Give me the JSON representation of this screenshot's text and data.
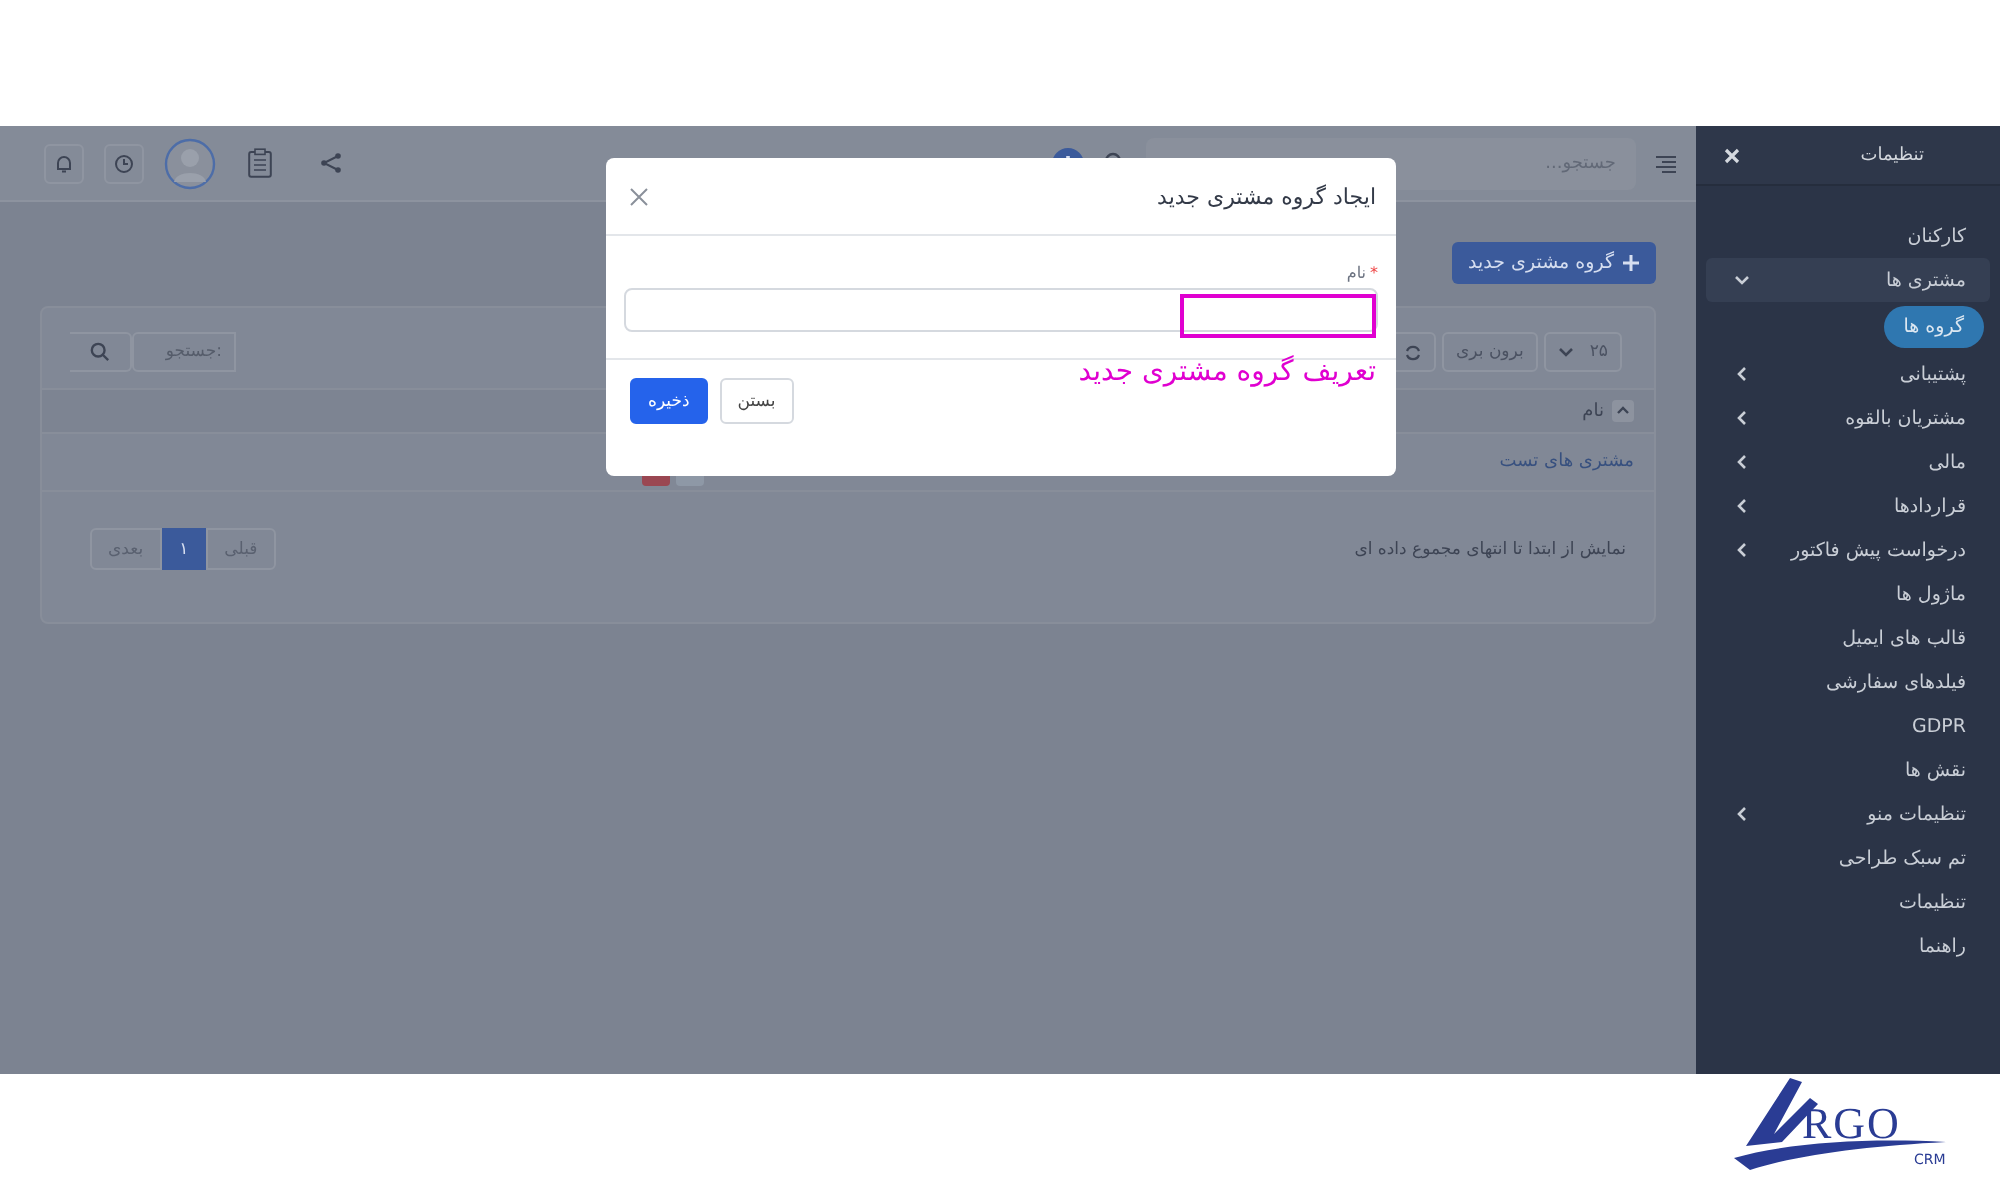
{
  "header": {
    "search_placeholder": "جستجو..."
  },
  "sidebar": {
    "title": "تنظیمات",
    "items": [
      {
        "label": "کارکنان",
        "has_submenu": false,
        "expanded": false
      },
      {
        "label": "مشتری ها",
        "has_submenu": true,
        "expanded": true,
        "children": [
          {
            "label": "گروه ها",
            "selected": true
          }
        ]
      },
      {
        "label": "پشتیبانی",
        "has_submenu": true,
        "expanded": false
      },
      {
        "label": "مشتریان بالقوه",
        "has_submenu": true,
        "expanded": false
      },
      {
        "label": "مالی",
        "has_submenu": true,
        "expanded": false
      },
      {
        "label": "قراردادها",
        "has_submenu": true,
        "expanded": false
      },
      {
        "label": "درخواست پیش فاکتور",
        "has_submenu": true,
        "expanded": false
      },
      {
        "label": "ماژول ها",
        "has_submenu": false,
        "expanded": false
      },
      {
        "label": "قالب های ایمیل",
        "has_submenu": false,
        "expanded": false
      },
      {
        "label": "فیلدهای سفارشی",
        "has_submenu": false,
        "expanded": false
      },
      {
        "label": "GDPR",
        "has_submenu": false,
        "expanded": false
      },
      {
        "label": "نقش ها",
        "has_submenu": false,
        "expanded": false
      },
      {
        "label": "تنظیمات منو",
        "has_submenu": true,
        "expanded": false
      },
      {
        "label": "تم سبک طراحی",
        "has_submenu": false,
        "expanded": false
      },
      {
        "label": "تنظیمات",
        "has_submenu": false,
        "expanded": false
      },
      {
        "label": "راهنما",
        "has_submenu": false,
        "expanded": false
      }
    ]
  },
  "main": {
    "new_button": "گروه مشتری جدید",
    "table": {
      "page_size": "۲۵",
      "export": "برون بری",
      "search_placeholder": "جستجو:",
      "columns": [
        {
          "label": "نام"
        }
      ],
      "rows": [
        {
          "name": "مشتری های تست"
        }
      ],
      "info": "نمایش از ابتدا تا انتهای مجموع داده ای",
      "pagination": {
        "previous": "قبلی",
        "pages": [
          {
            "label": "۱",
            "selected": true
          }
        ],
        "next": "بعدی"
      }
    }
  },
  "modal": {
    "title": "ایجاد گروه مشتری جدید",
    "field": {
      "label": "نام",
      "required_mark": "*"
    },
    "buttons": [
      {
        "label": "بستن",
        "kind": "secondary"
      },
      {
        "label": "ذخیره",
        "kind": "primary"
      }
    ]
  },
  "annotation": {
    "text": "تعریف گروه مشتری جدید"
  },
  "logo": {
    "text": "RGO",
    "subtext": "CRM"
  }
}
